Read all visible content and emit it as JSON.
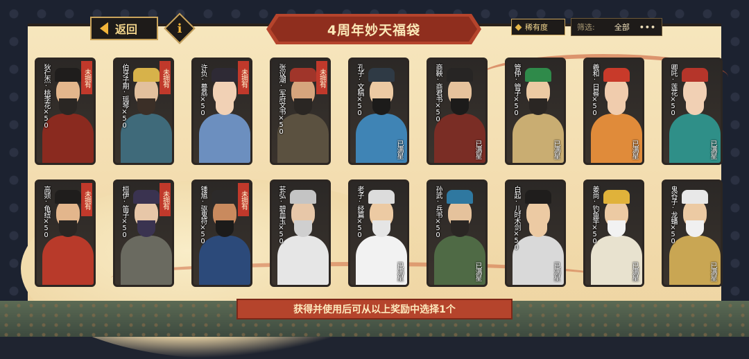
{
  "header": {
    "back_label": "返回",
    "info_label": "i",
    "title": "4周年妙天福袋",
    "rarity_label": "稀有度",
    "filter_label": "筛选:",
    "filter_value": "全部",
    "more_label": "•••"
  },
  "cards": [
    {
      "name": "狄仁杰·桃李花×50",
      "tag": "未拥有",
      "tag_type": "owned",
      "skin": "#e3b68c",
      "hat": "#1f1d1c",
      "robe": "#8a2a1f",
      "beard": "#2a2623"
    },
    {
      "name": "伯牙子期·瑶琴×50",
      "tag": "未拥有",
      "tag_type": "owned",
      "skin": "#e2c09d",
      "hat": "#d7b24a",
      "robe": "#3f6a7a",
      "beard": "#3b2f27"
    },
    {
      "name": "许负·謩荔×50",
      "tag": "未拥有",
      "tag_type": "owned",
      "skin": "#f1d1b5",
      "hat": "#2e2a35",
      "robe": "#6c8fbf",
      "beard": "#f1d1b5"
    },
    {
      "name": "张议潮·军府文书×50",
      "tag": "未拥有",
      "tag_type": "owned",
      "skin": "#d6a57d",
      "hat": "#a0352a",
      "robe": "#5b5140",
      "beard": "#2a2623"
    },
    {
      "name": "孔子·文稿×50",
      "tag": "已满星",
      "tag_type": "star",
      "skin": "#eccaa3",
      "hat": "#2f3a45",
      "robe": "#3f84b5",
      "beard": "#1c1b1a"
    },
    {
      "name": "商鞅·商君书×50",
      "tag": "已满星",
      "tag_type": "star",
      "skin": "#e5c29c",
      "hat": "#272524",
      "robe": "#7a2d25",
      "beard": "#1c1b1a"
    },
    {
      "name": "管仲·管子×50",
      "tag": "已满星",
      "tag_type": "star",
      "skin": "#eccaa3",
      "hat": "#2f8a4a",
      "robe": "#c9ad72",
      "beard": "#2a2623"
    },
    {
      "name": "羲和·日晷×50",
      "tag": "已满星",
      "tag_type": "star",
      "skin": "#f0ccad",
      "hat": "#c83a2a",
      "robe": "#e08b3a",
      "beard": "#f0ccad"
    },
    {
      "name": "卿吒·莲花×50",
      "tag": "已满星",
      "tag_type": "star",
      "skin": "#f1d0b4",
      "hat": "#b5352a",
      "robe": "#2f8f88",
      "beard": "#f1d0b4"
    },
    {
      "name": "高颎·龟纽×50",
      "tag": "未拥有",
      "tag_type": "owned",
      "skin": "#e3b68c",
      "hat": "#1f1d1c",
      "robe": "#b83a2a",
      "beard": "#2a2623"
    },
    {
      "name": "桓伊·笛子×50",
      "tag": "未拥有",
      "tag_type": "owned",
      "skin": "#e7c7a8",
      "hat": "#3a3350",
      "robe": "#6a6a60",
      "beard": "#3a3350"
    },
    {
      "name": "锺馗·驱鬼符×50",
      "tag": "未拥有",
      "tag_type": "owned",
      "skin": "#c98a5e",
      "hat": "#2c2a2a",
      "robe": "#2c4a7a",
      "beard": "#1c1b1a"
    },
    {
      "name": "苌弘·碧血玉×50",
      "tag": "",
      "tag_type": "none",
      "skin": "#e7c7a8",
      "hat": "#c4c4c4",
      "robe": "#e6e6e6",
      "beard": "#cfcfcf"
    },
    {
      "name": "老子·经篇×50",
      "tag": "已满星",
      "tag_type": "star",
      "skin": "#eccaa3",
      "hat": "#dcdcdc",
      "robe": "#f2f2f2",
      "beard": "#e5e5e5"
    },
    {
      "name": "孙武·兵书×50",
      "tag": "已满星",
      "tag_type": "star",
      "skin": "#e5c29c",
      "hat": "#2f78a0",
      "robe": "#4f6a45",
      "beard": "#2a2623"
    },
    {
      "name": "白起·儿时木剑×50",
      "tag": "已满星",
      "tag_type": "star",
      "skin": "#eccaa3",
      "hat": "#1f1d1c",
      "robe": "#d9d9d9",
      "beard": "#eccaa3"
    },
    {
      "name": "姜尚·钓鱼竿×50",
      "tag": "已满星",
      "tag_type": "star",
      "skin": "#eccaa3",
      "hat": "#e0b23a",
      "robe": "#e8e2cf",
      "beard": "#f2f2f2"
    },
    {
      "name": "鬼谷子·龙蟠×50",
      "tag": "已满星",
      "tag_type": "star",
      "skin": "#eccaa3",
      "hat": "#e8e8e8",
      "robe": "#c9a653",
      "beard": "#f0f0f0"
    }
  ],
  "footer": {
    "hint": "获得并使用后可从以上奖励中选择1个"
  }
}
